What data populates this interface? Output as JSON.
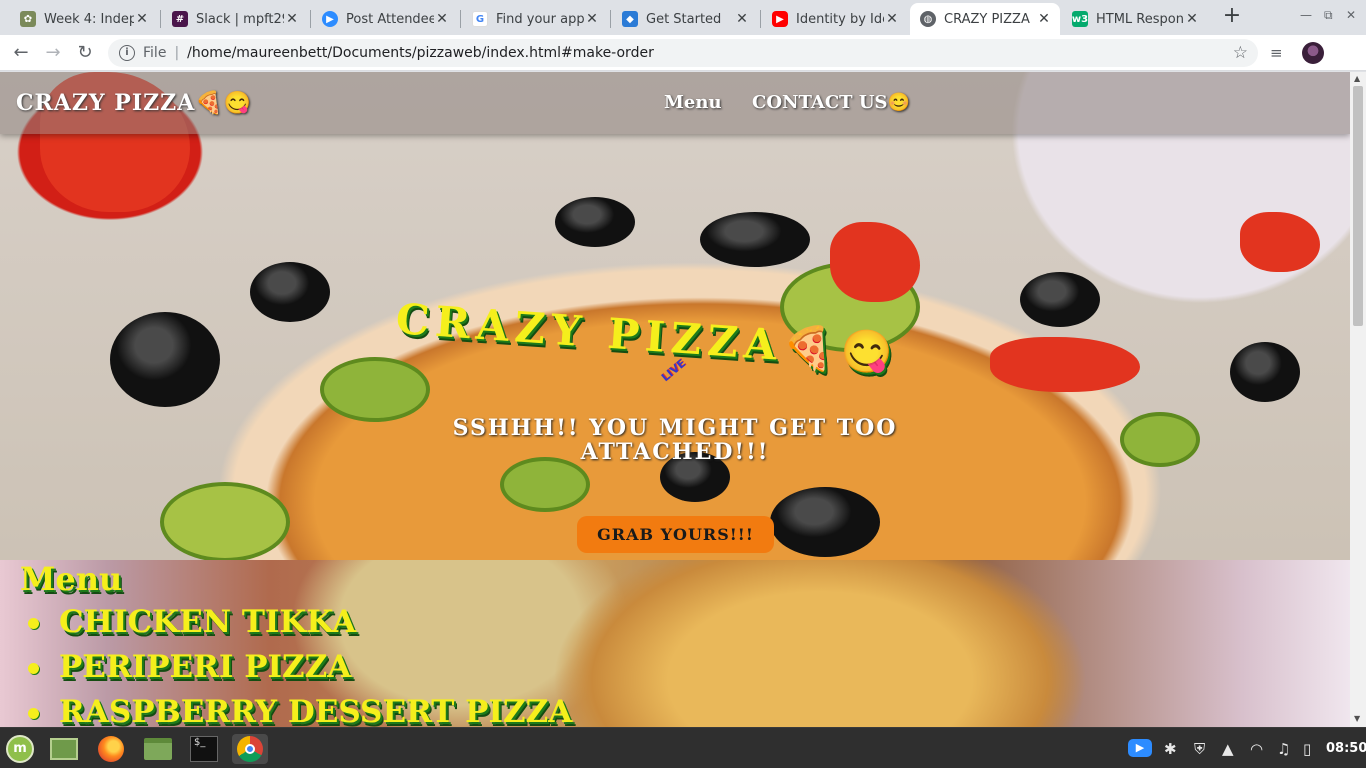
{
  "browser": {
    "tabs": [
      {
        "title": "Week 4: Indepe",
        "icon": "leaf-icon",
        "color": "#7b8a5a"
      },
      {
        "title": "Slack | mpft29",
        "icon": "slack-icon",
        "color": "#4a154b"
      },
      {
        "title": "Post Attendee",
        "icon": "zoom-icon",
        "color": "#2d8cff"
      },
      {
        "title": "Find your app",
        "icon": "google-icon",
        "color": "#4285f4"
      },
      {
        "title": "Get Started",
        "icon": "code-icon",
        "color": "#2b7bd6"
      },
      {
        "title": "Identity by Ider",
        "icon": "youtube-icon",
        "color": "#ff0000"
      },
      {
        "title": "CRAZY PIZZA",
        "icon": "globe-icon",
        "color": "#5f6368"
      },
      {
        "title": "HTML Respons",
        "icon": "w3-icon",
        "color": "#04aa6d"
      }
    ],
    "active_tab_index": 6,
    "address": {
      "scheme_label": "File",
      "url": "/home/maureenbett/Documents/pizzaweb/index.html#make-order"
    }
  },
  "page": {
    "brand": "CRAZY PIZZA🍕😋",
    "nav": {
      "menu": "Menu",
      "contact": "CONTACT US😊"
    },
    "hero": {
      "title": "CRAZY PIZZA🍕😋",
      "live_tag": "LIVE",
      "subtitle": "SSHHH!! YOU MIGHT GET TOO ATTACHED!!!",
      "button": "GRAB YOURS!!!"
    },
    "menu_section": {
      "heading": "Menu",
      "items": [
        "CHICKEN TIKKA",
        "PERIPERI PIZZA",
        "RASPBERRY DESSERT PIZZA"
      ]
    }
  },
  "taskbar": {
    "apps": [
      {
        "name": "mint-menu-icon"
      },
      {
        "name": "desktop-icon"
      },
      {
        "name": "firefox-icon"
      },
      {
        "name": "files-icon"
      },
      {
        "name": "terminal-icon"
      },
      {
        "name": "chrome-icon"
      }
    ],
    "clock": "08:50"
  }
}
